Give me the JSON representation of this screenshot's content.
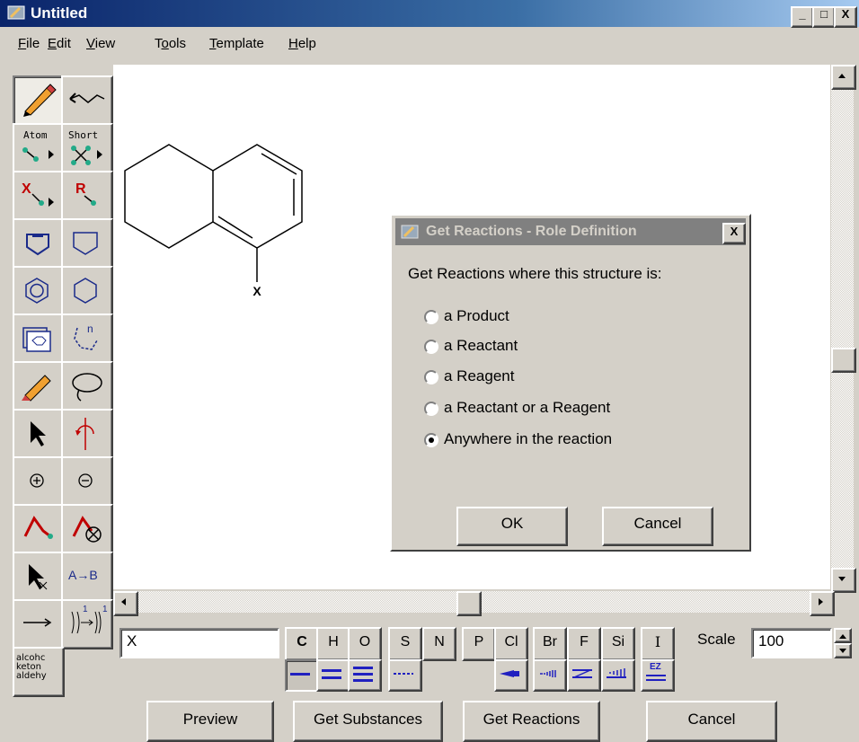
{
  "window": {
    "title": "Untitled",
    "controls": [
      "_",
      "□",
      "X"
    ]
  },
  "menu": [
    {
      "label": "File",
      "mnemonic": "F",
      "rest": "ile"
    },
    {
      "label": "Edit",
      "mnemonic": "E",
      "rest": "dit"
    },
    {
      "label": "View",
      "mnemonic": "V",
      "rest": "iew"
    },
    {
      "label": "Tools",
      "mnemonic": "o",
      "pre": "T",
      "rest": "ols"
    },
    {
      "label": "Template",
      "mnemonic": "T",
      "rest": "emplate"
    },
    {
      "label": "Help",
      "mnemonic": "H",
      "rest": "elp"
    }
  ],
  "palette": {
    "atom_label": "Atom",
    "short_label": "Short",
    "x_label": "X",
    "r_label": "R",
    "n_label": "n",
    "ab_label": "A→B",
    "map_label": "1",
    "abbrev_lines": [
      "alcohc",
      "keton",
      "aldehy"
    ]
  },
  "structure": {
    "substituent_label": "X"
  },
  "dialog": {
    "title": "Get Reactions - Role Definition",
    "close": "X",
    "prompt": "Get Reactions where this structure is:",
    "options": [
      {
        "label": "a Product",
        "selected": false
      },
      {
        "label": "a Reactant",
        "selected": false
      },
      {
        "label": "a Reagent",
        "selected": false
      },
      {
        "label": "a Reactant or a Reagent",
        "selected": false
      },
      {
        "label": "Anywhere in the reaction",
        "selected": true
      }
    ],
    "ok": "OK",
    "cancel": "Cancel"
  },
  "toolbar": {
    "text_input_value": "X",
    "elements": [
      "C",
      "H",
      "O",
      "S",
      "N",
      "P",
      "Cl",
      "Br",
      "F",
      "Si",
      "I"
    ],
    "scale_label": "Scale",
    "scale_value": "100",
    "bond_accent": "#2020c0",
    "stereo_labels": [
      "EZ"
    ]
  },
  "buttons": {
    "preview": "Preview",
    "get_substances": "Get Substances",
    "get_reactions": "Get Reactions",
    "cancel": "Cancel"
  }
}
